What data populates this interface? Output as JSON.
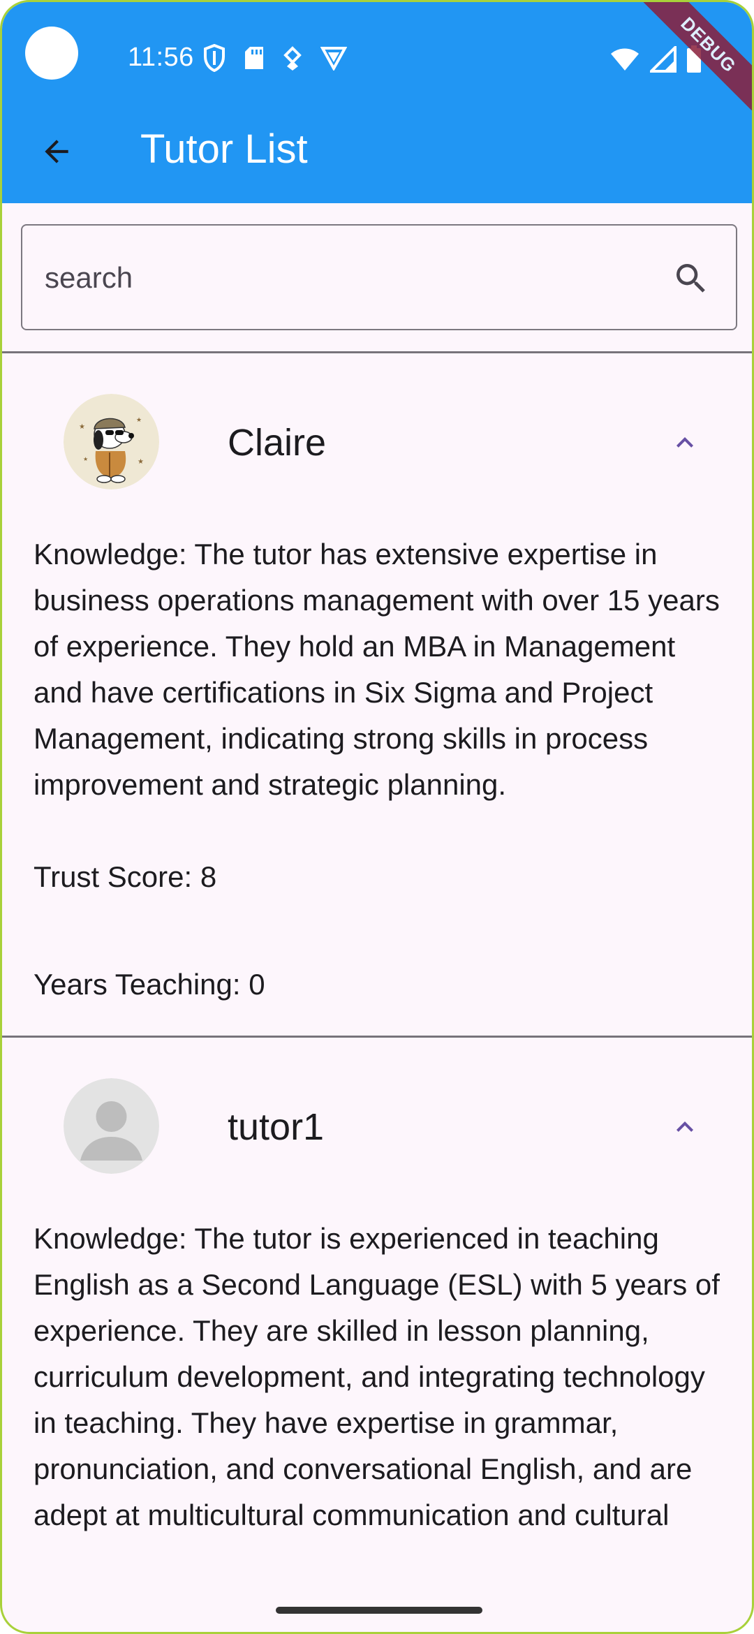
{
  "status_bar": {
    "time": "11:56",
    "debug_label": "DEBUG"
  },
  "app_bar": {
    "title": "Tutor List",
    "back_icon": "arrow-back-icon"
  },
  "search": {
    "placeholder": "search",
    "value": "",
    "icon": "search-icon"
  },
  "tutors": [
    {
      "name": "Claire",
      "avatar": "snoopy-avatar",
      "knowledge": "Knowledge: The tutor has extensive expertise in business operations management with over 15 years of experience. They hold an MBA in Management and have certifications in Six Sigma and Project Management, indicating strong skills in process improvement and strategic planning.",
      "trust_score": "Trust Score: 8",
      "years_teaching": "Years Teaching: 0"
    },
    {
      "name": "tutor1",
      "avatar": "default-person-avatar",
      "knowledge": "Knowledge: The tutor is experienced in teaching English as a Second Language (ESL) with 5 years of experience. They are skilled in lesson planning, curriculum development, and integrating technology in teaching. They have expertise in grammar, pronunciation, and conversational English, and are adept at multicultural communication and cultural",
      "trust_score": "",
      "years_teaching": ""
    }
  ],
  "colors": {
    "app_bar": "#2196f3",
    "background": "#fdf6fc",
    "accent": "#6750a4",
    "debug_ribbon": "#8a1f3a"
  }
}
